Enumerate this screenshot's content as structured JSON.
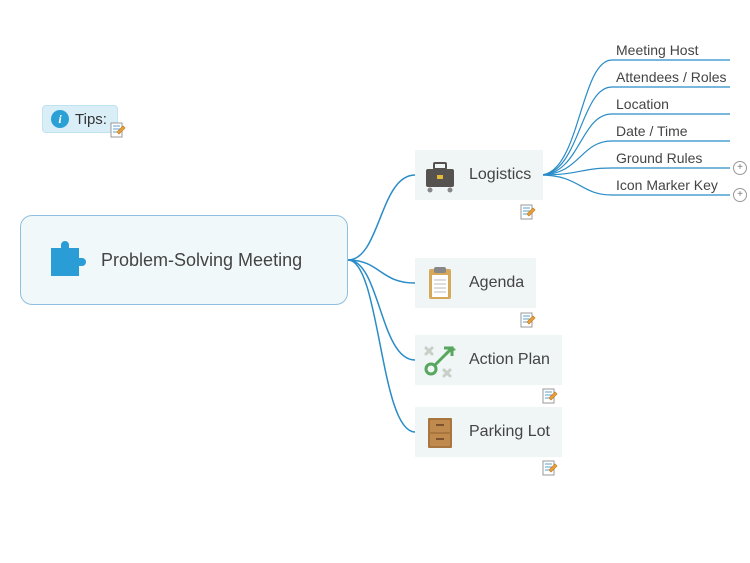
{
  "tips": {
    "label": "Tips:"
  },
  "root": {
    "title": "Problem-Solving Meeting"
  },
  "categories": {
    "logistics": {
      "label": "Logistics"
    },
    "agenda": {
      "label": "Agenda"
    },
    "actionplan": {
      "label": "Action Plan"
    },
    "parkinglot": {
      "label": "Parking Lot"
    }
  },
  "leaves": {
    "meetinghost": "Meeting Host",
    "attendees": "Attendees / Roles",
    "location": "Location",
    "datetime": "Date / Time",
    "groundrules": "Ground Rules",
    "iconmarker": "Icon Marker Key"
  },
  "colors": {
    "connector": "#2a8cc7",
    "leafline": "#2a8cc7",
    "rootfill": "#f0f8fa",
    "rootborder": "#8fbfe0",
    "tilefill": "#f0f5f5",
    "tipsfill": "#d9eef7"
  }
}
